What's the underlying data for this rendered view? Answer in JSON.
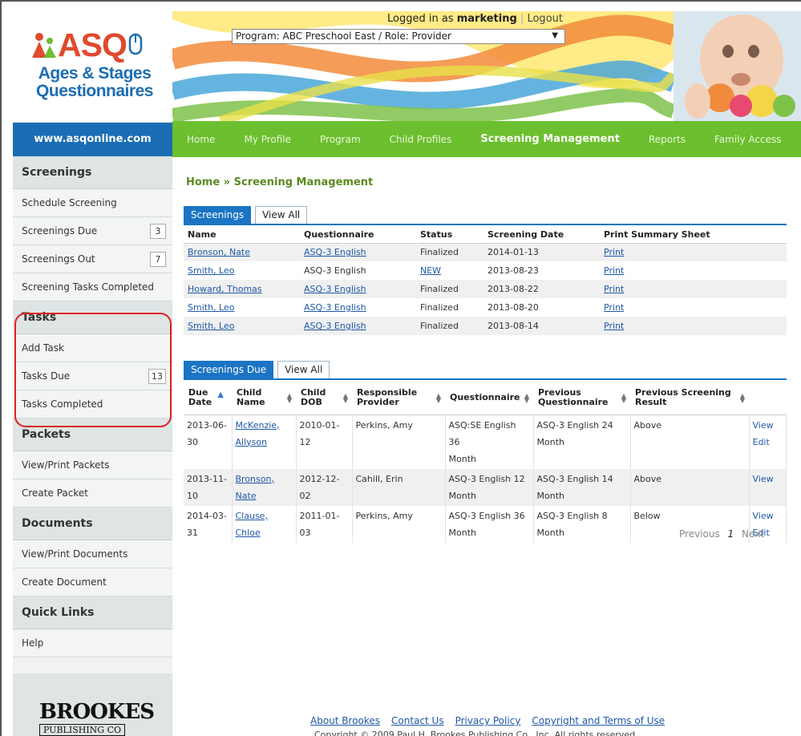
{
  "logo": {
    "text": "ASQ",
    "subtitle_line1": "Ages & Stages",
    "subtitle_line2": "Questionnaires",
    "url": "www.asqonline.com"
  },
  "header": {
    "logged_in_prefix": "Logged in as",
    "username": "marketing",
    "separator": "|",
    "logout": "Logout",
    "program_select": "Program: ABC Preschool East / Role: Provider"
  },
  "nav": [
    "Home",
    "My Profile",
    "Program",
    "Child Profiles",
    "Screening Management",
    "Reports",
    "Family Access"
  ],
  "nav_active": "Screening Management",
  "sidebar": {
    "screenings_head": "Screenings",
    "schedule": "Schedule Screening",
    "due": "Screenings Due",
    "due_count": "3",
    "out": "Screenings Out",
    "out_count": "7",
    "completed": "Screening Tasks Completed",
    "tasks_head": "Tasks",
    "add_task": "Add Task",
    "tasks_due": "Tasks Due",
    "tasks_due_count": "13",
    "tasks_completed": "Tasks Completed",
    "packets_head": "Packets",
    "view_packets": "View/Print Packets",
    "create_packet": "Create Packet",
    "documents_head": "Documents",
    "view_documents": "View/Print Documents",
    "create_document": "Create Document",
    "quicklinks_head": "Quick Links",
    "help": "Help",
    "brookes_word": "BROOKES",
    "brookes_sub": "PUBLISHING CO"
  },
  "breadcrumb": "Home » Screening Management",
  "tabs1": [
    "Screenings",
    "View All"
  ],
  "table1": {
    "headers": [
      "Name",
      "Questionnaire",
      "Status",
      "Screening Date",
      "Print Summary Sheet"
    ],
    "rows": [
      [
        "Bronson, Nate",
        "ASQ-3 English",
        "Finalized",
        "2014-01-13",
        "Print"
      ],
      [
        "Smith, Leo",
        "ASQ-3 English",
        "NEW",
        "2013-08-23",
        "Print"
      ],
      [
        "Howard, Thomas",
        "ASQ-3 English",
        "Finalized",
        "2013-08-22",
        "Print"
      ],
      [
        "Smith, Leo",
        "ASQ-3 English",
        "Finalized",
        "2013-08-20",
        "Print"
      ],
      [
        "Smith, Leo",
        "ASQ-3 English",
        "Finalized",
        "2013-08-14",
        "Print"
      ]
    ]
  },
  "tabs2": [
    "Screenings Due",
    "View All"
  ],
  "table2": {
    "headers": [
      [
        "Due",
        "Date"
      ],
      [
        "Child",
        "Name"
      ],
      [
        "Child",
        "DOB"
      ],
      [
        "Responsible",
        "Provider"
      ],
      [
        "Questionnaire",
        ""
      ],
      [
        "Previous",
        "Questionnaire"
      ],
      [
        "Previous Screening",
        "Result"
      ]
    ],
    "rows": [
      {
        "due": "2013-06-30",
        "name1": "McKenzie,",
        "name2": "Allyson",
        "dob": "2010-01-12",
        "provider": "Perkins, Amy",
        "q1": "ASQ:SE English 36",
        "q2": "Month",
        "prev": "ASQ-3 English 24 Month",
        "result": "Above",
        "view": "View",
        "edit": "Edit"
      },
      {
        "due": "2013-11-10",
        "name1": "Bronson,",
        "name2": "Nate",
        "dob": "2012-12-02",
        "provider": "Cahill, Erin",
        "q1": "ASQ-3 English 12",
        "q2": "Month",
        "prev": "ASQ-3 English 14 Month",
        "result": "Above",
        "view": "View",
        "edit": ""
      },
      {
        "due": "2014-03-31",
        "name1": "Clause,",
        "name2": "Chloe",
        "dob": "2011-01-03",
        "provider": "Perkins, Amy",
        "q1": "ASQ-3 English 36",
        "q2": "Month",
        "prev": "ASQ-3 English 8 Month",
        "result": "Below",
        "view": "View",
        "edit": "Edit"
      }
    ]
  },
  "pager": {
    "prev": "Previous",
    "page": "1",
    "next": "Next"
  },
  "footer": {
    "links": [
      "About Brookes",
      "Contact Us",
      "Privacy Policy",
      "Copyright and Terms of Use"
    ],
    "copyright": "Copyright © 2009 Paul H. Brookes Publishing Co., Inc. All rights reserved."
  },
  "colors": {
    "brand_blue": "#1b6db3",
    "nav_green": "#6cbf2e",
    "tab_blue": "#1b74c4",
    "highlight_red": "#e02020",
    "logo_orange": "#e04a2f"
  }
}
